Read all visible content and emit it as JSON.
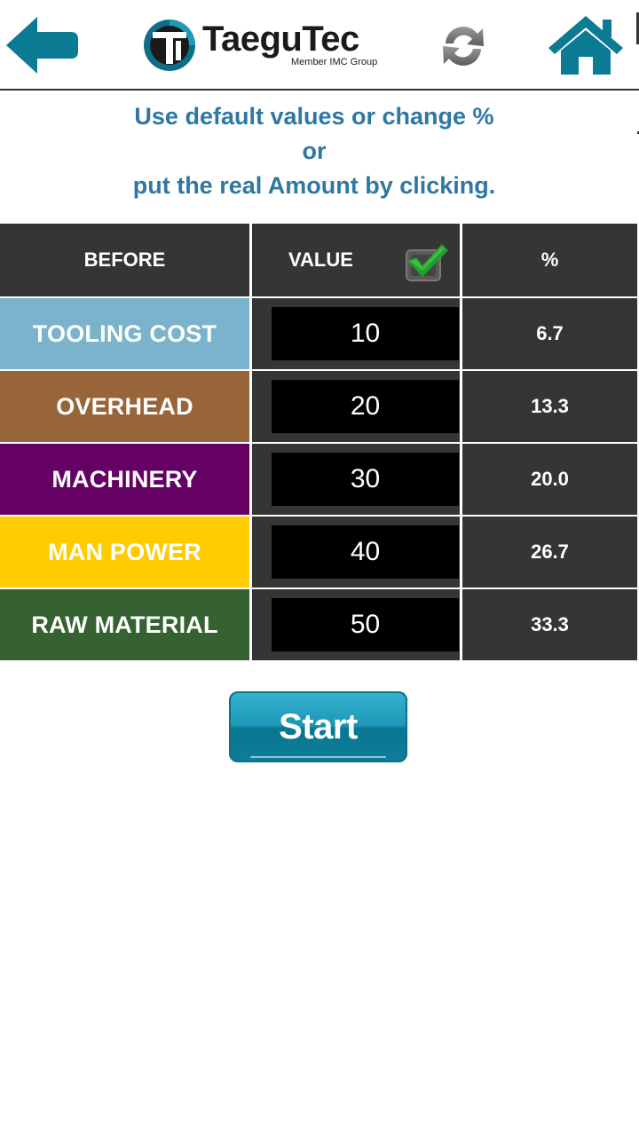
{
  "header": {
    "brand": "TaeguTec",
    "brand_tagline": "Member IMC Group"
  },
  "instructions": {
    "line1": "Use default values or change %",
    "line2": "or",
    "line3": "put the real Amount by clicking."
  },
  "table": {
    "headers": {
      "category": "BEFORE",
      "value": "VALUE",
      "percent": "%"
    },
    "value_checkbox_checked": true,
    "rows": [
      {
        "label": "TOOLING COST",
        "value": "10",
        "percent": "6.7",
        "color": "#7bb3cd"
      },
      {
        "label": "OVERHEAD",
        "value": "20",
        "percent": "13.3",
        "color": "#98653a"
      },
      {
        "label": "MACHINERY",
        "value": "30",
        "percent": "20.0",
        "color": "#650065"
      },
      {
        "label": "MAN POWER",
        "value": "40",
        "percent": "26.7",
        "color": "#fecc00"
      },
      {
        "label": "RAW MATERIAL",
        "value": "50",
        "percent": "33.3",
        "color": "#356230"
      }
    ]
  },
  "start_button": {
    "label": "Start"
  },
  "colors": {
    "accent": "#0a7f9a",
    "instruction_text": "#2f78a3",
    "table_dark": "#353535",
    "check_green": "#22a02c"
  }
}
